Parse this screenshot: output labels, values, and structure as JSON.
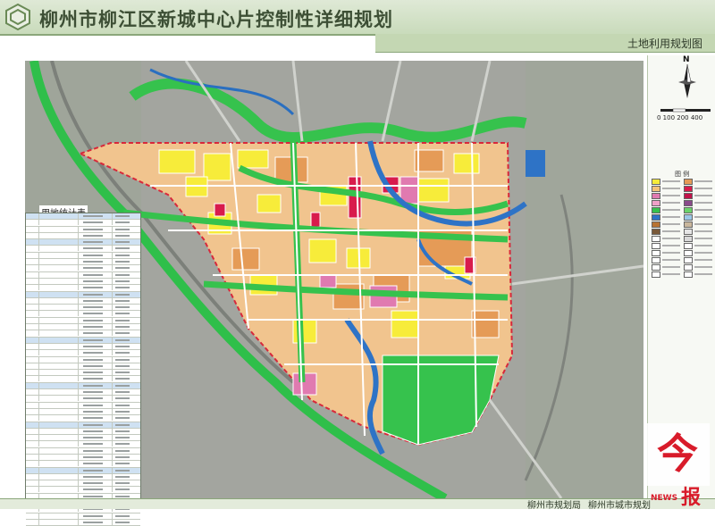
{
  "header": {
    "title": "柳州市柳江区新城中心片控制性详细规划",
    "subtitle": "土地利用规划图"
  },
  "compass": {
    "north_label": "N"
  },
  "scale": {
    "labels": "0 100 200  400"
  },
  "legend": {
    "title": "图 例"
  },
  "stat_table": {
    "title": "用地统计表"
  },
  "footer": {
    "left": "柳州市规划局",
    "right": "柳州市城市规划"
  },
  "stamp": {
    "text": "今",
    "text2": "报",
    "text3": "NEWS"
  },
  "colors": {
    "residential": "#f7ec3a",
    "commercial": "#e8a36b",
    "public": "#d81b4c",
    "green": "#38c94a",
    "water": "#2e73c6",
    "pink": "#e07ab0",
    "boundary": "#d8283a"
  }
}
